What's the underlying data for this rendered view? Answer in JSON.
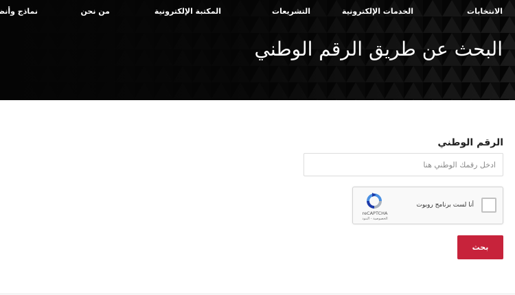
{
  "nav": {
    "items": [
      {
        "label": "الانتخابات"
      },
      {
        "label": "الخدمات الإلكترونية"
      },
      {
        "label": "التشريعات"
      },
      {
        "label": "المكتبة الإلكترونية"
      },
      {
        "label": "من نحن"
      },
      {
        "label": "نماذج وأنظ"
      }
    ]
  },
  "hero": {
    "title": "البحث عن طريق الرقم الوطني"
  },
  "form": {
    "national_number_label": "الرقم الوطني",
    "national_number_placeholder": "ادخل رقمك الوطني هنا",
    "national_number_value": "",
    "captcha": {
      "checkbox_label": "أنا لست برنامج روبوت",
      "brand": "reCAPTCHA",
      "links": "الخصوصية - البنود",
      "checked": false
    },
    "search_button_label": "بحث"
  },
  "colors": {
    "hero_background": "#050505",
    "button": "#c7233b",
    "text": "#222222"
  }
}
